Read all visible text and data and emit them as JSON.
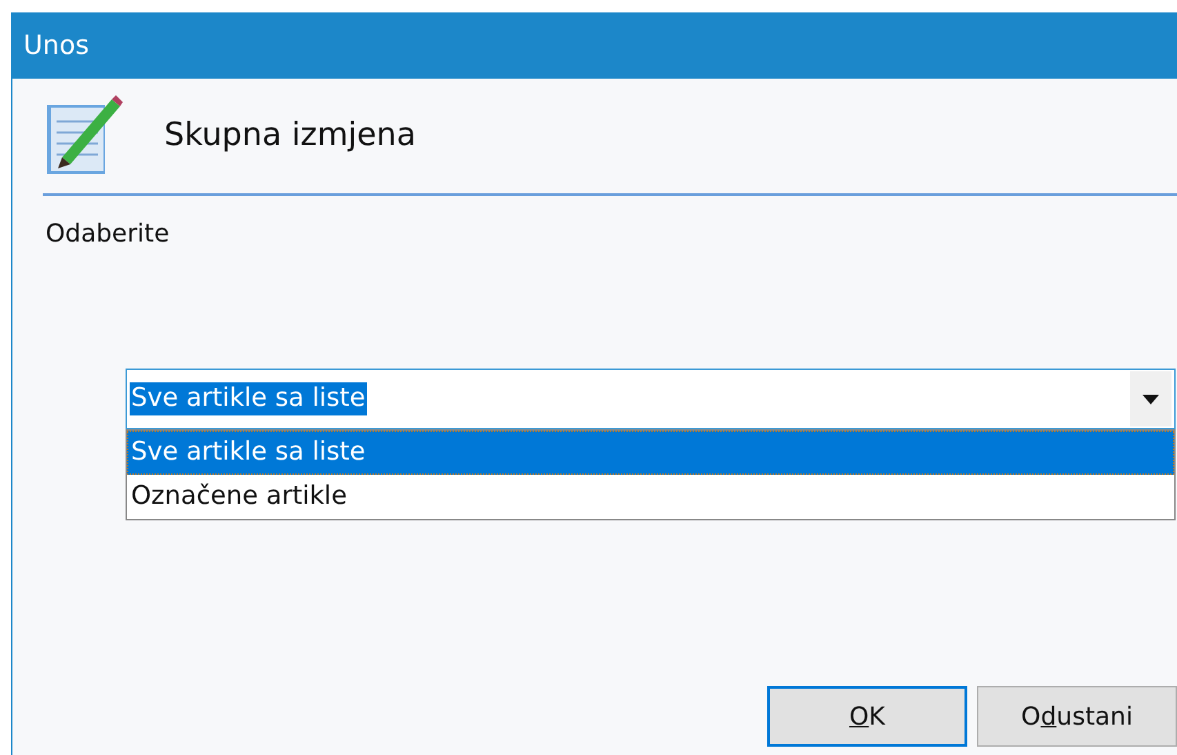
{
  "window": {
    "title": "Unos"
  },
  "header": {
    "title": "Skupna izmjena"
  },
  "prompt": "Odaberite",
  "combo": {
    "value": "Sve artikle sa liste",
    "expanded": true,
    "options": [
      {
        "label": "Sve artikle sa liste",
        "selected": true
      },
      {
        "label": "Označene artikle",
        "selected": false
      }
    ]
  },
  "buttons": [
    {
      "key": "O",
      "post": "K",
      "default": true
    },
    {
      "pre": "O",
      "key": "d",
      "post": "ustani",
      "default": false
    }
  ]
}
